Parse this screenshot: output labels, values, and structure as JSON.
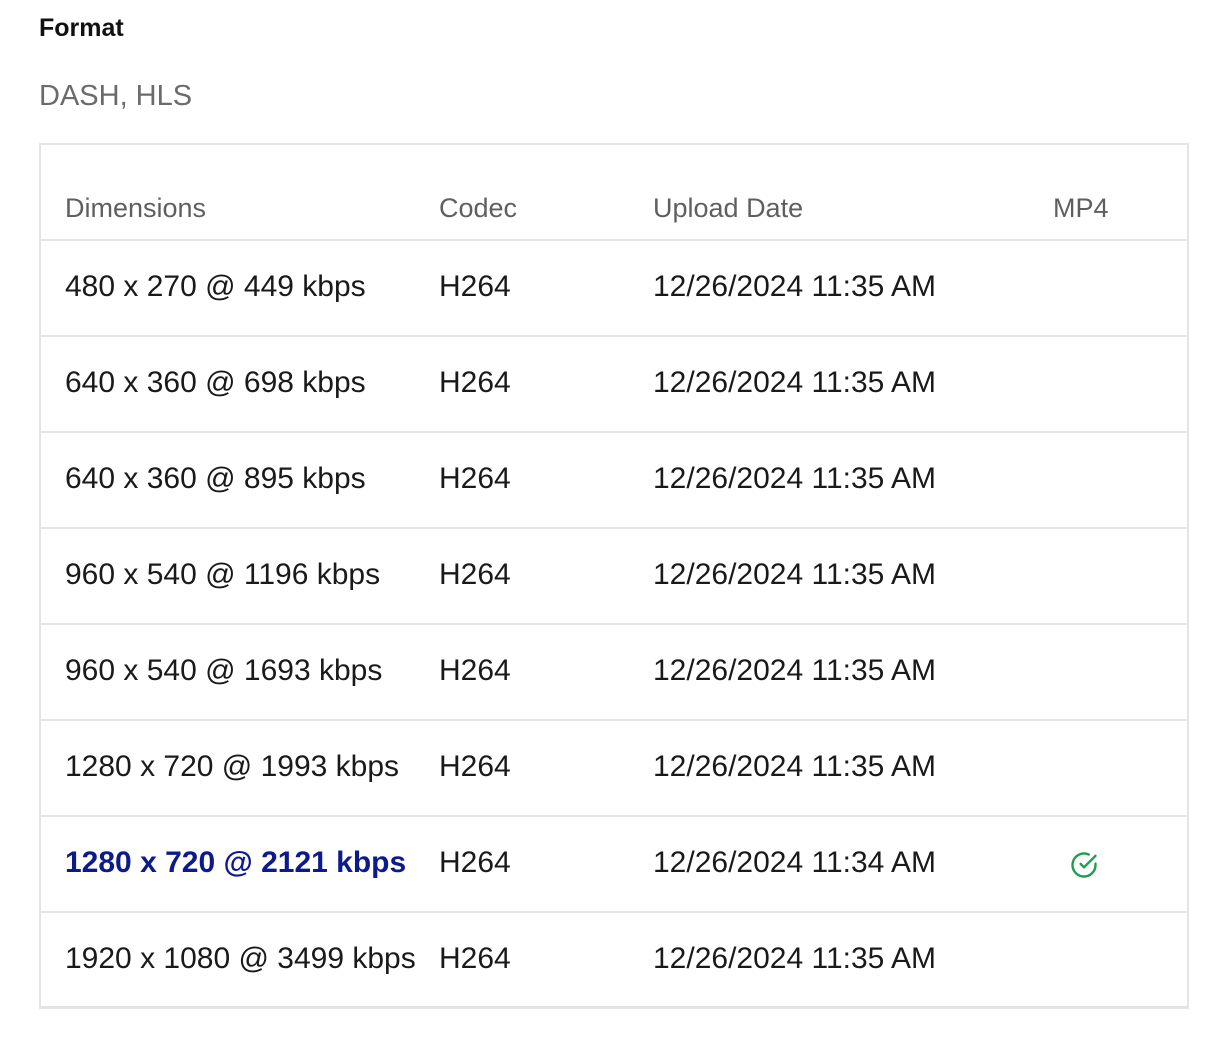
{
  "format": {
    "label": "Format",
    "value": "DASH, HLS"
  },
  "table": {
    "headers": {
      "dimensions": "Dimensions",
      "codec": "Codec",
      "upload_date": "Upload Date",
      "mp4": "MP4"
    },
    "rows": [
      {
        "dimensions": "480 x 270 @ 449 kbps",
        "codec": "H264",
        "upload_date": "12/26/2024 11:35 AM",
        "mp4": false
      },
      {
        "dimensions": "640 x 360 @ 698 kbps",
        "codec": "H264",
        "upload_date": "12/26/2024 11:35 AM",
        "mp4": false
      },
      {
        "dimensions": "640 x 360 @ 895 kbps",
        "codec": "H264",
        "upload_date": "12/26/2024 11:35 AM",
        "mp4": false
      },
      {
        "dimensions": "960 x 540 @ 1196 kbps",
        "codec": "H264",
        "upload_date": "12/26/2024 11:35 AM",
        "mp4": false
      },
      {
        "dimensions": "960 x 540 @ 1693 kbps",
        "codec": "H264",
        "upload_date": "12/26/2024 11:35 AM",
        "mp4": false
      },
      {
        "dimensions": "1280 x 720 @ 1993 kbps",
        "codec": "H264",
        "upload_date": "12/26/2024 11:35 AM",
        "mp4": false
      },
      {
        "dimensions": "1280 x 720 @ 2121 kbps",
        "codec": "H264",
        "upload_date": "12/26/2024 11:34 AM",
        "mp4": true,
        "selected": true
      },
      {
        "dimensions": "1920 x 1080 @ 3499 kbps",
        "codec": "H264",
        "upload_date": "12/26/2024 11:35 AM",
        "mp4": false
      }
    ]
  },
  "colors": {
    "selected_text": "#0d1a8c",
    "check_icon": "#1e9e4a",
    "border": "#e4e4e4",
    "muted_text": "#6b6b6b"
  },
  "icons": {
    "mp4_available": "check-circle-icon"
  }
}
